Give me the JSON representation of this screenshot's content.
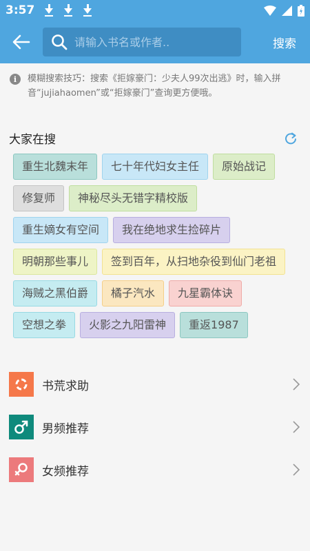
{
  "status": {
    "time": "3:57"
  },
  "search": {
    "placeholder": "请输入书名或作者..",
    "button": "搜索"
  },
  "tip": {
    "text": "模糊搜索技巧：搜索《拒嫁豪门：少夫人99次出逃》时，输入拼音“jujiahaomen”或“拒嫁豪门”查询更方便哦。"
  },
  "hot": {
    "title": "大家在搜",
    "tags": [
      "重生北魏末年",
      "七十年代妇女主任",
      "原始战记",
      "修复师",
      "神秘尽头无错字精校版",
      "重生嫡女有空间",
      "我在绝地求生捡碎片",
      "明朝那些事儿",
      "签到百年，从扫地杂役到仙门老祖",
      "海贼之黑伯爵",
      "橘子汽水",
      "九星霸体诀",
      "空想之拳",
      "火影之九阳雷神",
      "重返1987"
    ]
  },
  "menu": [
    {
      "label": "书荒求助",
      "icon": "lifebuoy-icon",
      "color": "#f5784a"
    },
    {
      "label": "男频推荐",
      "icon": "male-icon",
      "color": "#0f8a7c"
    },
    {
      "label": "女频推荐",
      "icon": "female-icon",
      "color": "#ec7a7c"
    }
  ],
  "colors": {
    "primary": "#4fa6df",
    "search_bg": "#3f8dc3",
    "accent": "#4fa6df"
  }
}
